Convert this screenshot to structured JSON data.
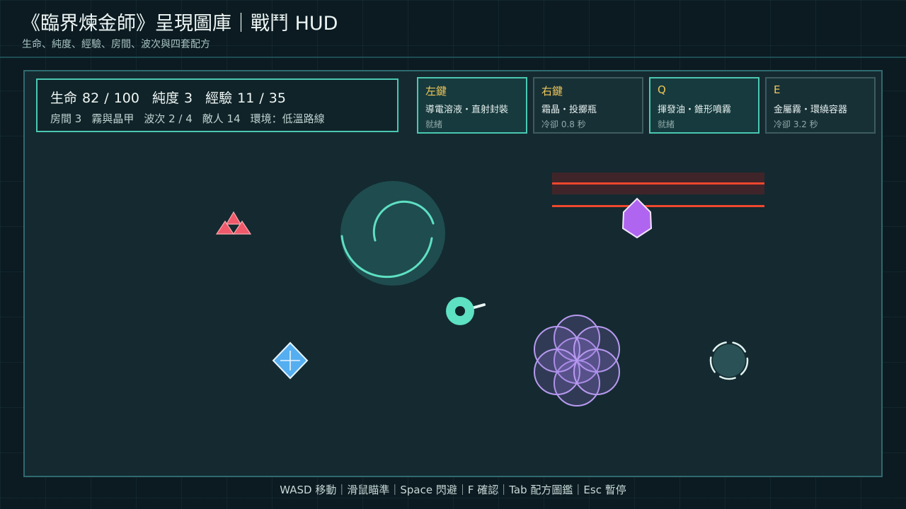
{
  "header": {
    "title": "《臨界煉金師》呈現圖庫｜戰鬥 HUD",
    "subtitle": "生命、純度、經驗、房間、波次與四套配方"
  },
  "stats": {
    "hp": "生命 82 / 100",
    "purity": "純度 3",
    "xp": "經驗 11 / 35",
    "room": "房間 3",
    "zone": "霧與晶甲",
    "wave": "波次 2 / 4",
    "enemies": "敵人 14",
    "environment": "環境：低溫路線"
  },
  "player": {
    "hp": 82,
    "hp_max": 100,
    "purity": 3,
    "xp": 11,
    "xp_max": 35,
    "wave": 2,
    "wave_total": 4,
    "enemies": 14
  },
  "skills": [
    {
      "key": "左鍵",
      "name": "導電溶液・直射封裝",
      "status": "就緒",
      "ready": true
    },
    {
      "key": "右鍵",
      "name": "霜晶・投擲瓶",
      "status": "冷卻 0.8 秒",
      "ready": false
    },
    {
      "key": "Q",
      "name": "揮發油・錐形噴霧",
      "status": "就緒",
      "ready": true
    },
    {
      "key": "E",
      "name": "金屬霧・環繞容器",
      "status": "冷卻 3.2 秒",
      "ready": false
    }
  ],
  "footer": {
    "controls": "WASD 移動｜滑鼠瞄準｜Space 閃避｜F 確認｜Tab 配方圖鑑｜Esc 暫停"
  },
  "colors": {
    "accent": "#4bc7b2",
    "player": "#5ee0c3",
    "key_label": "#f0c75a",
    "enemy_red": "#f0596a",
    "enemy_purple": "#b065f0",
    "frost": "#55aef0",
    "hazard_line": "#f0472e",
    "spore": "#b89af0"
  },
  "icons": {
    "player": "player-ring-icon",
    "vortex": "vortex-icon",
    "enemy_cluster": "red-triangle-cluster-icon",
    "crystal_enemy": "purple-crystal-icon",
    "frost_crystal": "frost-diamond-icon",
    "spore_cloud": "spore-flower-icon",
    "orb_enemy": "dark-orb-icon"
  }
}
